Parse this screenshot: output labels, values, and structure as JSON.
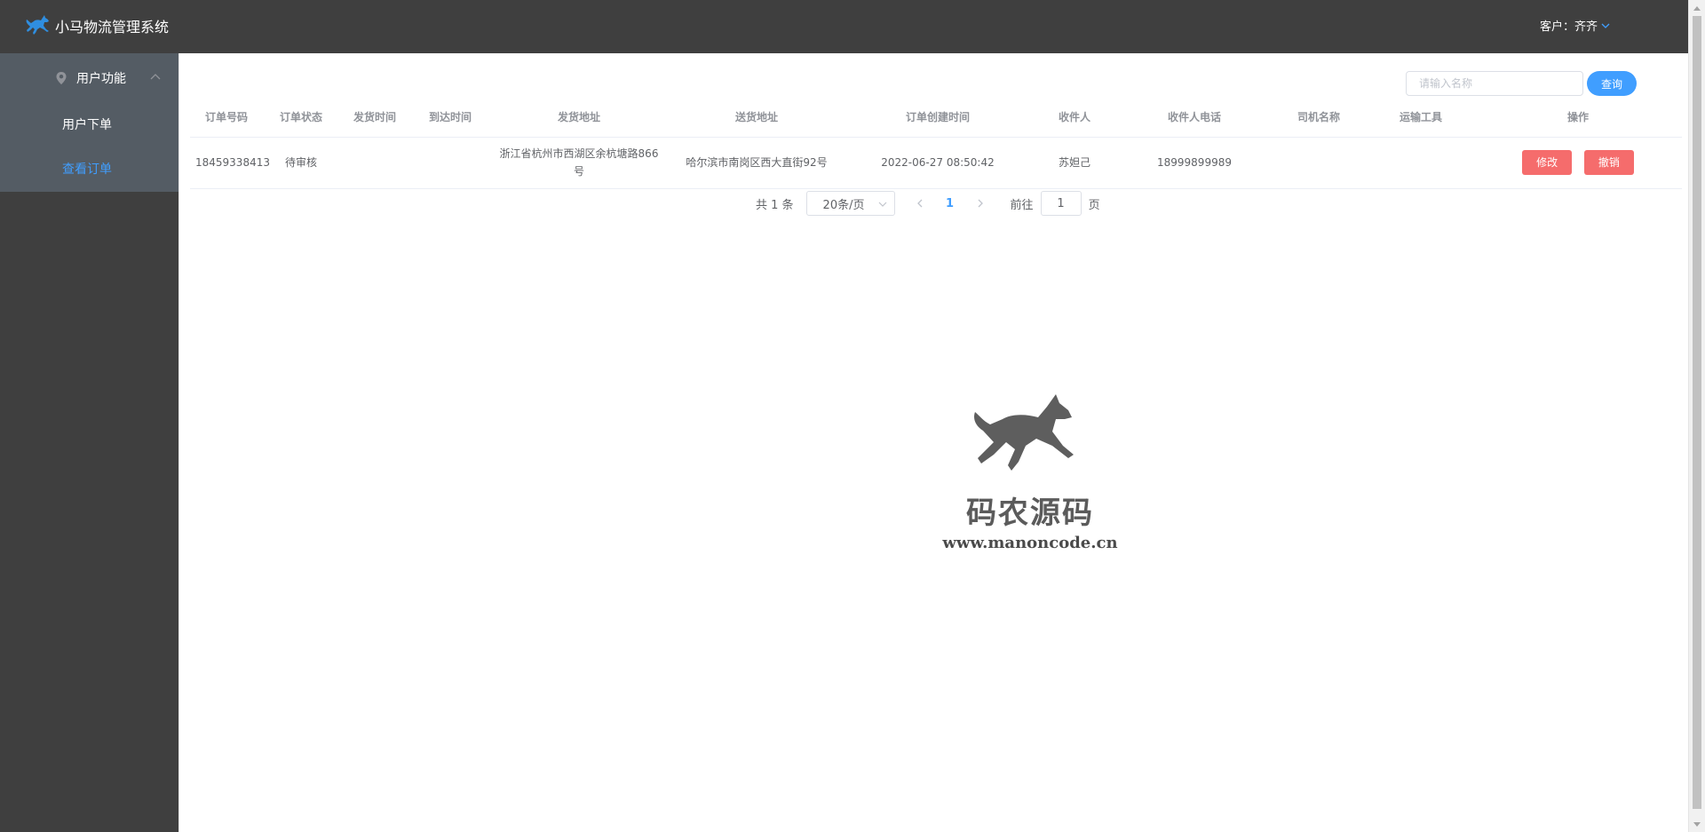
{
  "header": {
    "title": "小马物流管理系统",
    "logo_icon": "horse-icon",
    "user_label": "客户：齐齐"
  },
  "sidebar": {
    "group_label": "用户功能",
    "group_icon": "location-pin-icon",
    "items": [
      {
        "label": "用户下单",
        "active": false
      },
      {
        "label": "查看订单",
        "active": true
      }
    ]
  },
  "search": {
    "placeholder": "请输入名称",
    "button_label": "查询"
  },
  "table": {
    "columns": [
      "订单号码",
      "订单状态",
      "发货时间",
      "到达时间",
      "发货地址",
      "送货地址",
      "订单创建时间",
      "收件人",
      "收件人电话",
      "司机名称",
      "运输工具",
      "操作"
    ],
    "rows": [
      {
        "order_no": "18459338413",
        "status": "待审核",
        "ship_time": "",
        "arrive_time": "",
        "from_address": "浙江省杭州市西湖区余杭塘路866号",
        "to_address": "哈尔滨市南岗区西大直街92号",
        "created_at": "2022-06-27 08:50:42",
        "receiver": "苏妲己",
        "receiver_phone": "18999899989",
        "driver": "",
        "vehicle": "",
        "edit_label": "修改",
        "cancel_label": "撤销"
      }
    ]
  },
  "pagination": {
    "total_text": "共 1 条",
    "page_size": "20条/页",
    "current_page": "1",
    "goto_label": "前往",
    "goto_value": "1",
    "goto_suffix": "页"
  },
  "watermark": {
    "cn": "码农源码",
    "url": "www.manoncode.cn"
  },
  "colors": {
    "header_bg": "#3f3f3f",
    "menu_active": "#409eff",
    "danger": "#f56c6c",
    "primary": "#409eff"
  }
}
